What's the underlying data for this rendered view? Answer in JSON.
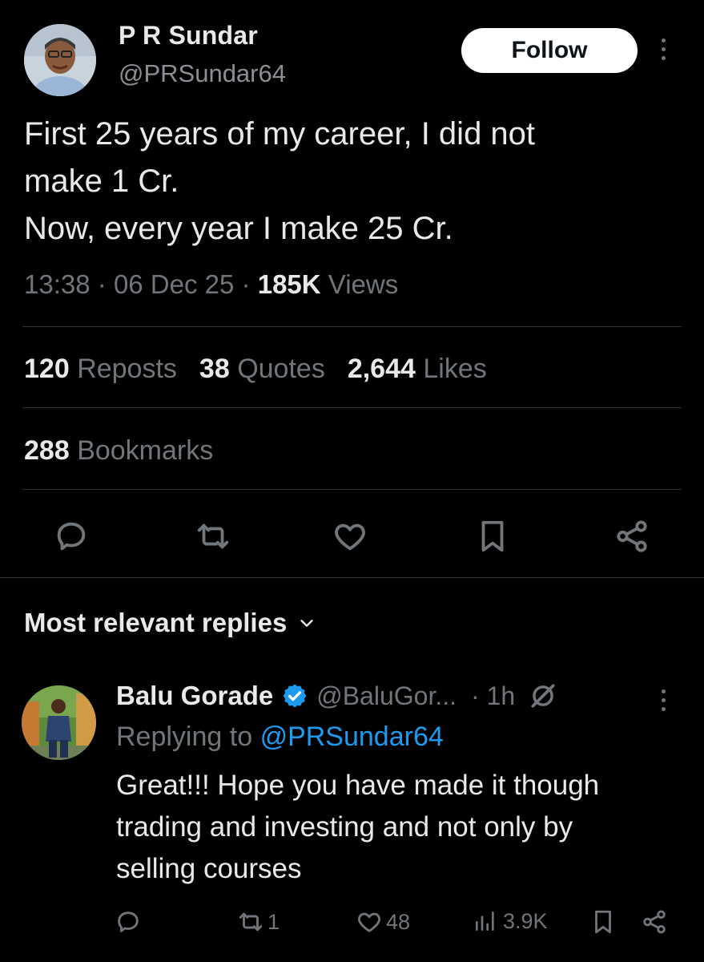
{
  "author": {
    "name": "P R Sundar",
    "handle": "@PRSundar64",
    "follow_label": "Follow"
  },
  "tweet": {
    "lines": [
      "First 25 years of my career, I did not",
      "make 1 Cr.",
      "Now, every year I make 25 Cr."
    ],
    "time": "13:38",
    "date": "06 Dec 25",
    "views_count": "185K",
    "views_label": "Views",
    "sep": "·"
  },
  "stats": {
    "reposts_count": "120",
    "reposts_label": "Reposts",
    "quotes_count": "38",
    "quotes_label": "Quotes",
    "likes_count": "2,644",
    "likes_label": "Likes",
    "bookmarks_count": "288",
    "bookmarks_label": "Bookmarks"
  },
  "actions": [
    "reply-icon",
    "repost-icon",
    "like-icon",
    "bookmark-icon",
    "share-icon"
  ],
  "replies_section": {
    "title": "Most relevant replies"
  },
  "reply": {
    "name": "Balu Gorade",
    "handle": "@BaluGor...",
    "time": "· 1h",
    "replying_prefix": "Replying to",
    "replying_handle": "@PRSundar64",
    "lines": [
      "Great!!! Hope you have made it though",
      "trading and investing and not only by",
      "selling courses"
    ],
    "repost_count": "1",
    "like_count": "48",
    "views_count": "3.9K"
  },
  "colors": {
    "background": "#000000",
    "text": "#e7e9ea",
    "muted": "#71767b",
    "link": "#1d9bf0",
    "verified": "#1d9bf0"
  }
}
